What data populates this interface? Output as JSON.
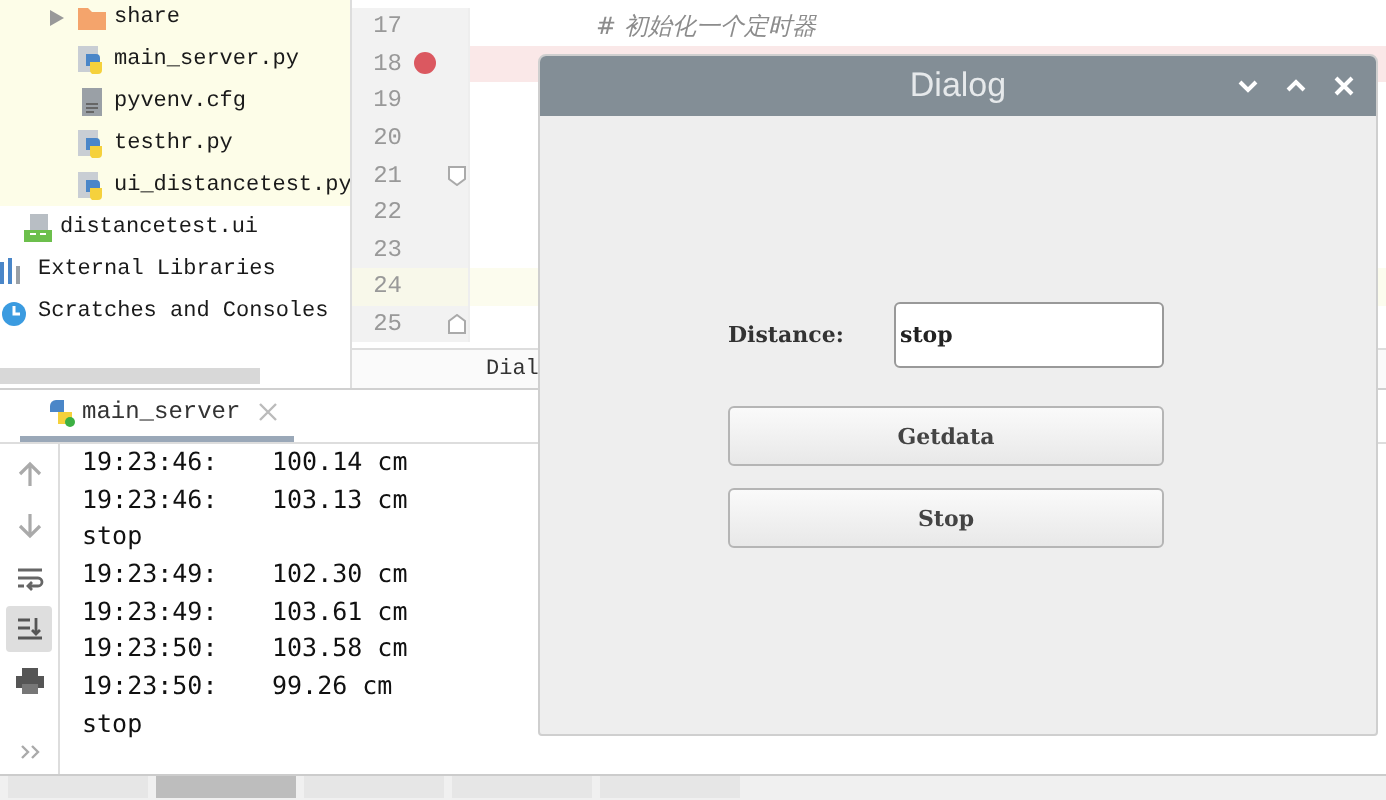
{
  "project_tree": {
    "items": [
      {
        "kind": "group",
        "children": [
          {
            "kind": "group",
            "highlighted": true,
            "children": [
              {
                "kind": "folder",
                "label": "share",
                "expanded": false
              },
              {
                "kind": "python",
                "label": "main_server.py"
              },
              {
                "kind": "text",
                "label": "pyvenv.cfg"
              },
              {
                "kind": "python",
                "label": "testhr.py"
              },
              {
                "kind": "python",
                "label": "ui_distancetest.py"
              }
            ]
          },
          {
            "kind": "qt",
            "label": "distancetest.ui"
          }
        ]
      },
      {
        "kind": "library",
        "label": "External Libraries"
      },
      {
        "kind": "scratches",
        "label": "Scratches and Consoles"
      }
    ]
  },
  "editor": {
    "lines": [
      {
        "number": "17",
        "text": "# 初始化一个定时器",
        "breakpoint": false,
        "caret_line": false,
        "fold_start": false,
        "fold_end": false
      },
      {
        "number": "18",
        "breakpoint": true,
        "caret_line": false,
        "fold_start": false,
        "fold_end": false
      },
      {
        "number": "19",
        "breakpoint": false,
        "caret_line": false,
        "fold_start": false,
        "fold_end": false
      },
      {
        "number": "20",
        "breakpoint": false,
        "caret_line": false,
        "fold_start": false,
        "fold_end": false
      },
      {
        "number": "21",
        "breakpoint": false,
        "caret_line": false,
        "fold_start": true,
        "fold_end": false
      },
      {
        "number": "22",
        "breakpoint": false,
        "caret_line": false,
        "fold_start": false,
        "fold_end": false
      },
      {
        "number": "23",
        "breakpoint": false,
        "caret_line": false,
        "fold_start": false,
        "fold_end": false
      },
      {
        "number": "24",
        "breakpoint": false,
        "caret_line": true,
        "fold_start": false,
        "fold_end": false
      },
      {
        "number": "25",
        "breakpoint": false,
        "caret_line": false,
        "fold_start": false,
        "fold_end": true
      }
    ],
    "breadcrumb": "Dial"
  },
  "run_panel": {
    "tabs": [
      {
        "label": "main_server",
        "selected": true
      }
    ],
    "toolbar": [
      {
        "kind": "up",
        "selected": false
      },
      {
        "kind": "down",
        "selected": false
      },
      {
        "kind": "wrap",
        "selected": false
      },
      {
        "kind": "scroll-end",
        "selected": true
      },
      {
        "kind": "print",
        "selected": false
      },
      {
        "kind": "more",
        "selected": false
      }
    ],
    "output": [
      {
        "kind": "reading",
        "time": "19:23:46:",
        "value": "100.14 cm"
      },
      {
        "kind": "reading",
        "time": "19:23:46:",
        "value": "103.13 cm"
      },
      {
        "kind": "message",
        "text": "stop"
      },
      {
        "kind": "reading",
        "time": "19:23:49:",
        "value": "102.30 cm"
      },
      {
        "kind": "reading",
        "time": "19:23:49:",
        "value": "103.61 cm"
      },
      {
        "kind": "reading",
        "time": "19:23:50:",
        "value": "103.58 cm"
      },
      {
        "kind": "reading",
        "time": "19:23:50:",
        "value": "99.26 cm"
      },
      {
        "kind": "message",
        "text": "stop"
      }
    ]
  },
  "tool_tabs": [
    {
      "selected": false
    },
    {
      "selected": true
    },
    {
      "selected": false
    },
    {
      "selected": false
    },
    {
      "selected": false
    }
  ],
  "dialog": {
    "title": "Dialog",
    "label": "Distance:",
    "field_value": "stop",
    "buttons": [
      "Getdata",
      "Stop"
    ]
  }
}
